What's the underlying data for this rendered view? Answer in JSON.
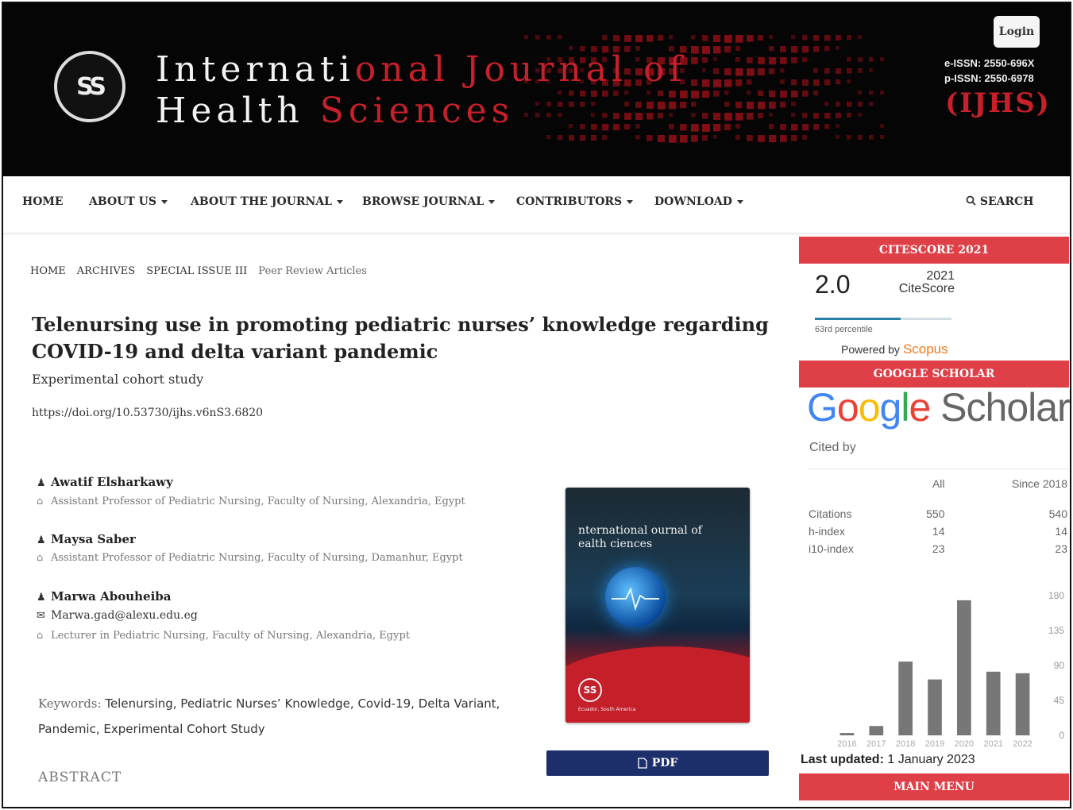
{
  "header": {
    "logo_text": "SS",
    "title_line1_white": "Internati",
    "title_line1_red": "onal Journal of",
    "title_line2_white": "Health",
    "title_line2_red": "Sciences",
    "login_label": "Login",
    "eissn": "e-ISSN: 2550-696X",
    "pissn": "p-ISSN: 2550-6978",
    "abbrev": "(IJHS)",
    "accent_color": "#c8202a"
  },
  "nav": {
    "items": [
      "HOME",
      "ABOUT US",
      "ABOUT THE JOURNAL",
      "BROWSE JOURNAL",
      "CONTRIBUTORS",
      "DOWNLOAD"
    ],
    "search_label": "SEARCH"
  },
  "breadcrumb": [
    "HOME",
    "ARCHIVES",
    "SPECIAL ISSUE III",
    "Peer Review Articles"
  ],
  "article": {
    "title": "Telenursing use in promoting pediatric nurses’ knowledge regarding COVID-19 and delta variant pandemic",
    "subtitle": "Experimental cohort study",
    "doi": "https://doi.org/10.53730/ijhs.v6nS3.6820",
    "authors": [
      {
        "name": "Awatif Elsharkawy",
        "affiliation": "Assistant Professor of Pediatric Nursing, Faculty of Nursing, Alexandria, Egypt"
      },
      {
        "name": "Maysa Saber",
        "affiliation": "Assistant Professor of Pediatric Nursing, Faculty of Nursing, Damanhur, Egypt"
      },
      {
        "name": "Marwa Abouheiba",
        "email": "Marwa.gad@alexu.edu.eg",
        "affiliation": "Lecturer in Pediatric Nursing, Faculty of Nursing, Alexandria, Egypt"
      }
    ],
    "keywords_label": "Keywords:",
    "keywords_line1": "Telenursing, Pediatric Nurses’ Knowledge, Covid-19, Delta Variant,",
    "keywords_line2": "Pandemic, Experimental Cohort Study",
    "abstract_label": "ABSTRACT",
    "pdf_label": "PDF",
    "cover": {
      "title_line1": "nternational ournal of",
      "title_line2": "ealth ciences",
      "logo": "SS",
      "footer": "Ecuador, South America"
    }
  },
  "sidebar": {
    "citescore_head": "CITESCORE 2021",
    "citescore_value": "2.0",
    "citescore_year": "2021",
    "citescore_label": "CiteScore",
    "percentile_text": "63rd percentile",
    "percentile_value": 0.63,
    "powered_by": "Powered by",
    "scopus": "Scopus",
    "scholar_head": "GOOGLE SCHOLAR",
    "scholar_logo_google": "Google",
    "scholar_logo_scholar": "Scholar",
    "cited_by": "Cited by",
    "table": {
      "col_all": "All",
      "col_since": "Since 2018",
      "rows": [
        {
          "label": "Citations",
          "all": "550",
          "since": "540"
        },
        {
          "label": "h-index",
          "all": "14",
          "since": "14"
        },
        {
          "label": "i10-index",
          "all": "23",
          "since": "23"
        }
      ]
    },
    "last_updated_label": "Last updated:",
    "last_updated_value": "1 January 2023",
    "main_menu_head": "MAIN MENU"
  },
  "chart_data": {
    "type": "bar",
    "categories": [
      "2016",
      "2017",
      "2018",
      "2019",
      "2020",
      "2021",
      "2022"
    ],
    "values": [
      3,
      12,
      95,
      72,
      174,
      82,
      80
    ],
    "ylim": [
      0,
      180
    ],
    "yticks": [
      0,
      45,
      90,
      135,
      180
    ],
    "bar_color": "#777777",
    "grid": false
  }
}
